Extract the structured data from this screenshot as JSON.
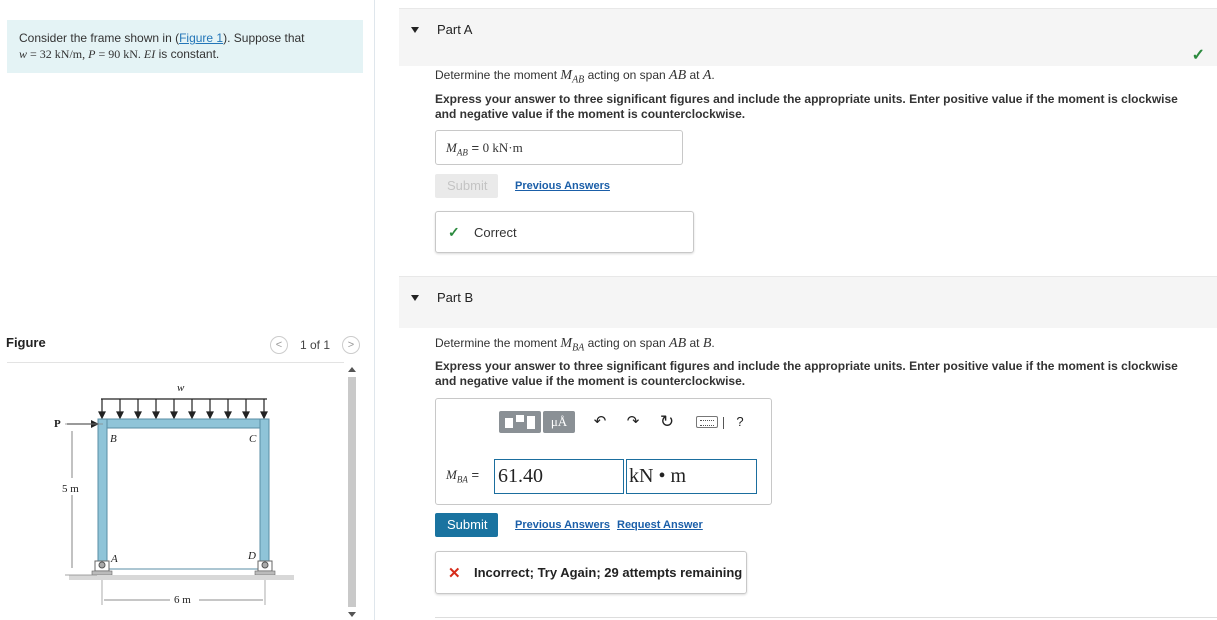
{
  "problem": {
    "text_before_link": "Consider the frame shown in (",
    "link": "Figure 1",
    "text_after_link": "). Suppose that",
    "line2_w": "w",
    "line2_eq1": " = 32 kN/m, ",
    "line2_p": "P",
    "line2_eq2": " = 90 kN. ",
    "line2_ei": "EI",
    "line2_tail": " is constant."
  },
  "figure": {
    "title": "Figure",
    "counter": "1 of 1",
    "prev": "<",
    "next": ">",
    "labels": {
      "w": "w",
      "P": "P",
      "B": "B",
      "C": "C",
      "A": "A",
      "D": "D",
      "height": "5 m",
      "width": "6 m"
    }
  },
  "partA": {
    "label": "Part A",
    "question_pre": "Determine the moment ",
    "question_sym": "M",
    "question_sub": "AB",
    "question_mid": " acting on span ",
    "question_span": "AB",
    "question_at": " at ",
    "question_pt": "A",
    "question_end": ".",
    "instructions": "Express your answer to three significant figures and include the appropriate units. Enter positive value if the moment is clockwise and negative value if the moment is counterclockwise.",
    "answer_sym": "M",
    "answer_sub": "AB",
    "answer_eq": " = ",
    "answer_value": "0 kN·m",
    "submit": "Submit",
    "previous_answers": "Previous Answers",
    "feedback": "Correct",
    "status_icon": "✓"
  },
  "partB": {
    "label": "Part B",
    "question_pre": "Determine the moment ",
    "question_sym": "M",
    "question_sub": "BA",
    "question_mid": " acting on span ",
    "question_span": "AB",
    "question_at": " at ",
    "question_pt": "B",
    "question_end": ".",
    "instructions": "Express your answer to three significant figures and include the appropriate units. Enter positive value if the moment is clockwise and negative value if the moment is counterclockwise.",
    "toolbar": {
      "units_label": "μÅ",
      "undo": "↶",
      "redo": "↷",
      "reset": "↻",
      "help": "?"
    },
    "answer_sym": "M",
    "answer_sub": "BA",
    "answer_eq": " = ",
    "value": "61.40",
    "units": "kN • m",
    "submit": "Submit",
    "previous_answers": "Previous Answers",
    "request_answer": "Request Answer",
    "feedback": "Incorrect; Try Again; 29 attempts remaining",
    "feedback_icon": "✕"
  },
  "colors": {
    "correct": "#2b8a3e",
    "incorrect": "#d62c1a",
    "frame": "#8fc4d8",
    "primary_button": "#1a73a0"
  }
}
